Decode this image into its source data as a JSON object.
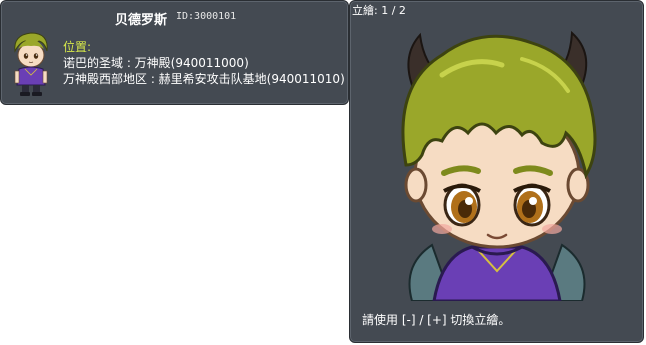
{
  "npc": {
    "name": "贝德罗斯",
    "id_text": "ID:3000101"
  },
  "location": {
    "label": "位置:",
    "lines": [
      "诺巴的圣域 : 万神殿(940011000)",
      "万神殿西部地区 : 赫里希安攻击队基地(940011010)"
    ]
  },
  "portrait": {
    "header": "立繪: 1 / 2",
    "hint": "請使用 [-] / [+] 切換立繪。"
  },
  "colors": {
    "panel_bg": "#444a52",
    "label_yellow": "#d6e84a",
    "hair_green": "#9aa72a",
    "shirt_purple": "#6a3fb5"
  },
  "icons": {
    "avatar": "npc-sprite",
    "portrait": "npc-illustration"
  }
}
